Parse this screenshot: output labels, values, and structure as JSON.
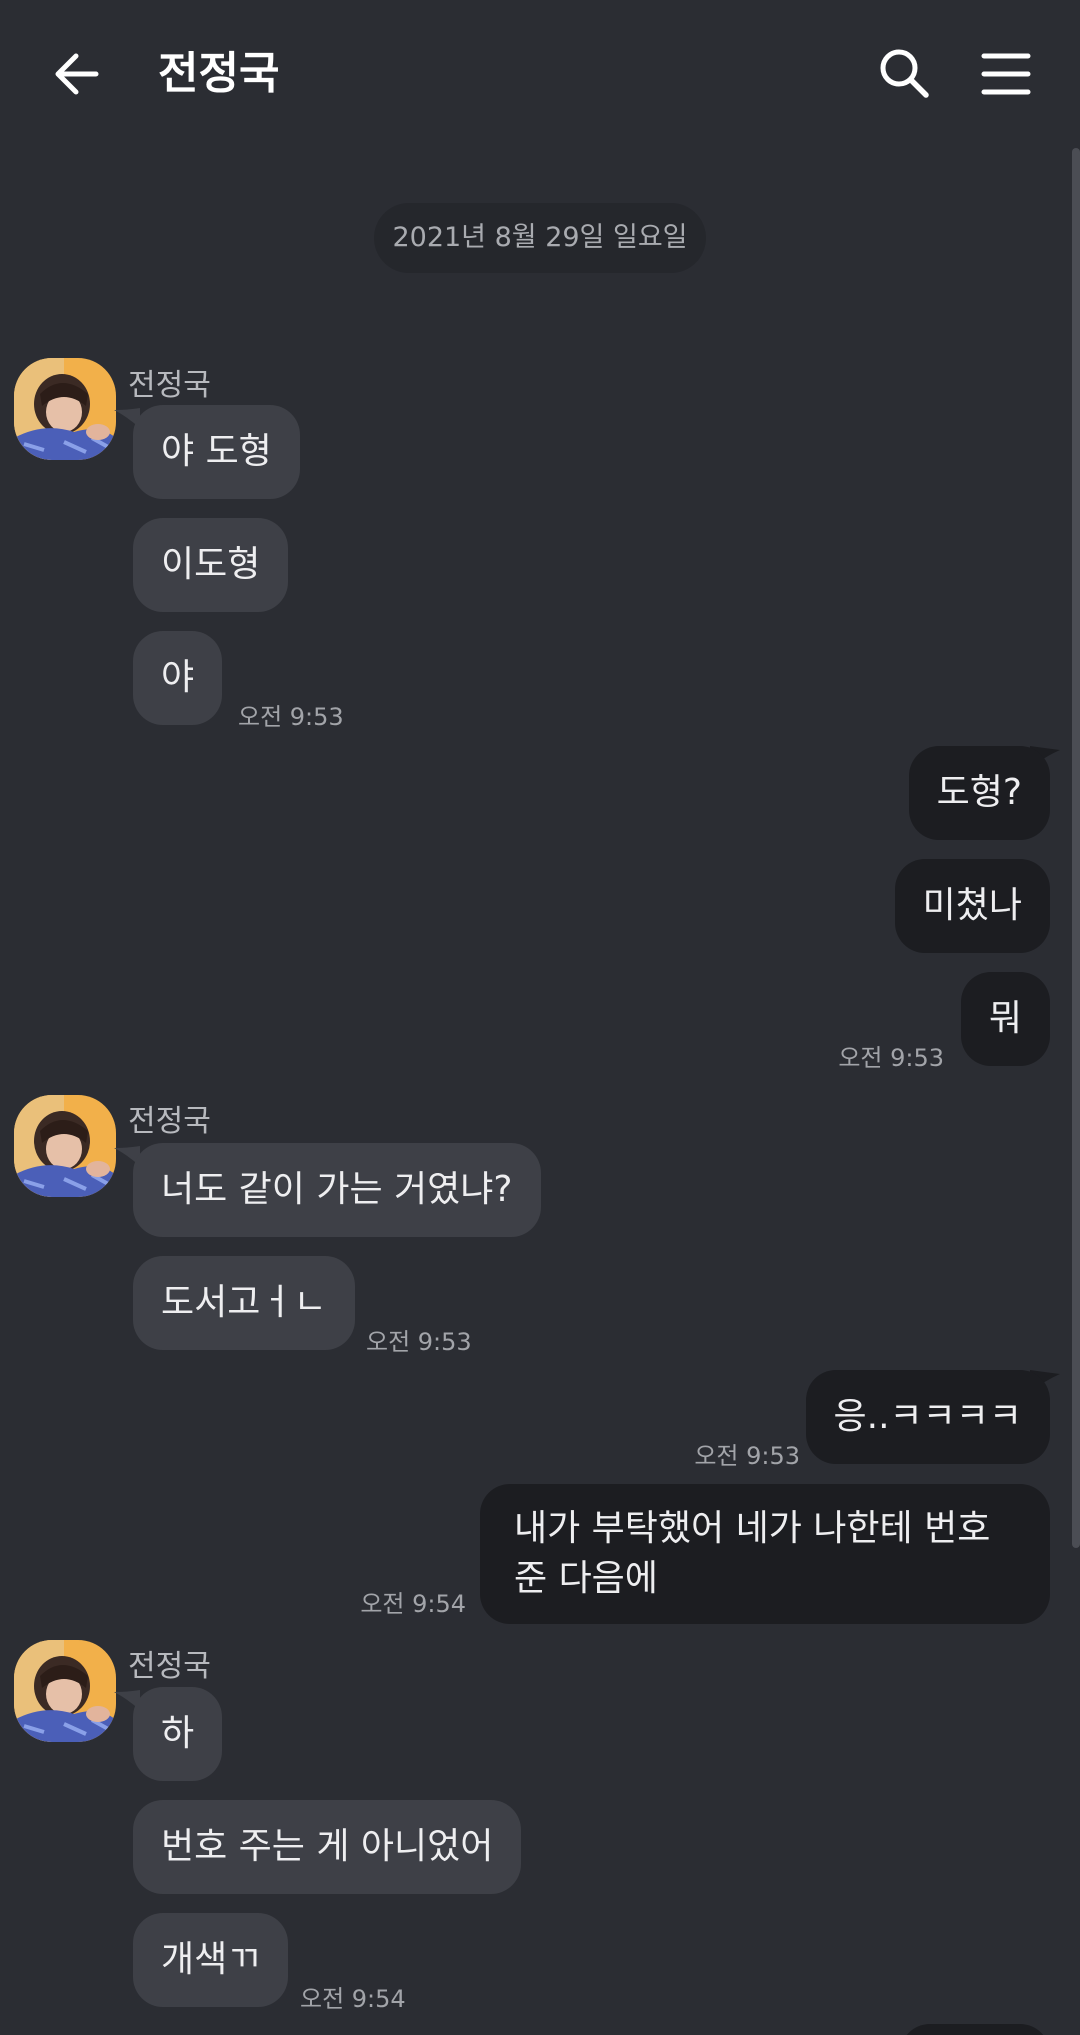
{
  "header": {
    "title": "전정국"
  },
  "date_divider": "2021년 8월 29일 일요일",
  "messages": {
    "g1": {
      "sender": "전정국",
      "m1": "야 도형",
      "m2": "이도형",
      "m3": "야",
      "time": "오전 9:53"
    },
    "o1": {
      "m1": "도형?",
      "m2": "미쳤나",
      "m3": "뭐",
      "time": "오전 9:53"
    },
    "g2": {
      "sender": "전정국",
      "m1": "너도 같이 가는 거였냐?",
      "m2": "도서고ㅓㄴ",
      "time": "오전 9:53"
    },
    "o2": {
      "m1": "응..ㅋㅋㅋㅋ",
      "time1": "오전 9:53",
      "m2": "내가 부탁했어 네가 나한테 번호 준 다음에",
      "time2": "오전 9:54"
    },
    "g3": {
      "sender": "전정국",
      "m1": "하",
      "m2": "번호 주는 게 아니었어",
      "m3": "개색ㄲ",
      "time": "오전 9:54"
    }
  },
  "icons": {
    "back": "arrow-left-icon",
    "search": "search-icon",
    "menu": "hamburger-menu-icon"
  },
  "colors": {
    "background": "#2b2d33",
    "incoming_bubble": "#3e4047",
    "outgoing_bubble": "#1c1d21",
    "date_pill": "#25272c"
  }
}
